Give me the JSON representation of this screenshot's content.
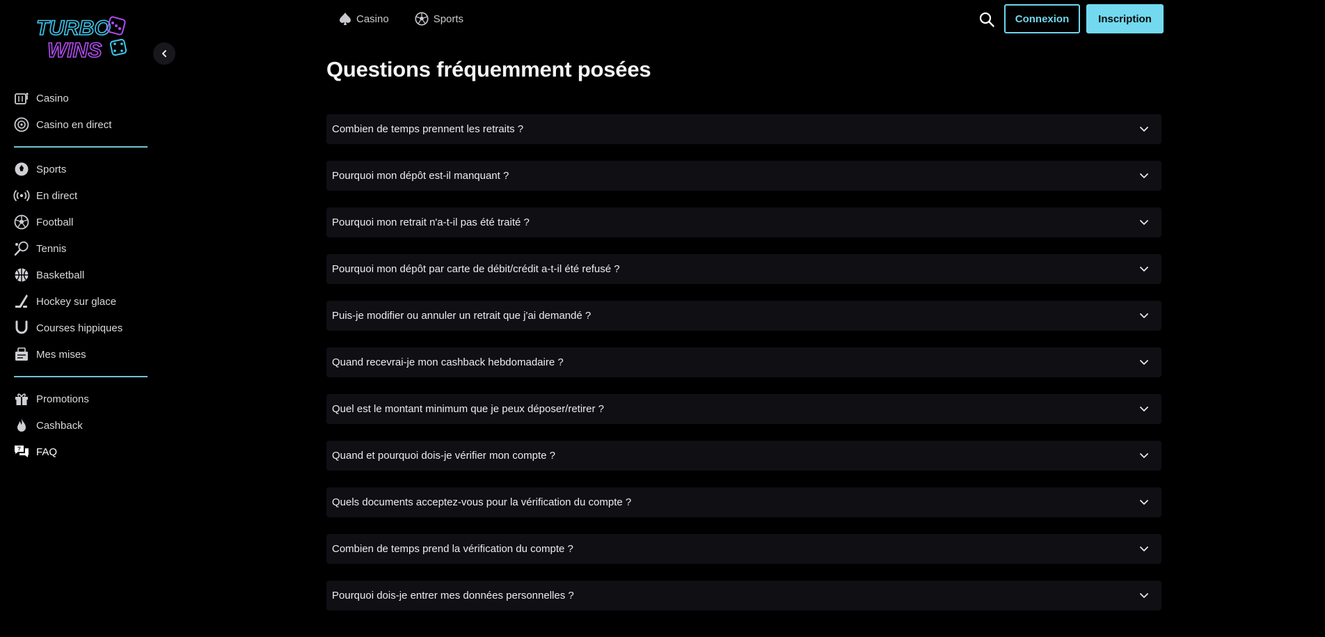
{
  "brand": {
    "logo_line1": "TURBO",
    "logo_line2": "WINS",
    "colors": {
      "logo_cyan": "#3ec9f0",
      "logo_magenta": "#b24cf2",
      "accent": "#72d9ef",
      "divider": "#6fc4d2"
    }
  },
  "sidebar": {
    "collapse_icon": "chevron-left-icon",
    "groups": [
      [
        {
          "label": "Casino",
          "icon": "slot-machine-icon"
        },
        {
          "label": "Casino en direct",
          "icon": "roulette-icon"
        }
      ],
      [
        {
          "label": "Sports",
          "icon": "sports-icon"
        },
        {
          "label": "En direct",
          "icon": "live-broadcast-icon"
        },
        {
          "label": "Football",
          "icon": "soccer-ball-icon"
        },
        {
          "label": "Tennis",
          "icon": "tennis-racket-icon"
        },
        {
          "label": "Basketball",
          "icon": "basketball-icon"
        },
        {
          "label": "Hockey sur glace",
          "icon": "hockey-stick-icon"
        },
        {
          "label": "Courses hippiques",
          "icon": "horseshoe-icon"
        },
        {
          "label": "Mes mises",
          "icon": "bet-slip-icon"
        }
      ],
      [
        {
          "label": "Promotions",
          "icon": "gift-icon"
        },
        {
          "label": "Cashback",
          "icon": "flame-icon"
        },
        {
          "label": "FAQ",
          "icon": "faq-chat-icon",
          "active": true
        }
      ]
    ]
  },
  "topnav": {
    "casino_label": "Casino",
    "sports_label": "Sports",
    "search_icon": "search-icon",
    "login_label": "Connexion",
    "signup_label": "Inscription"
  },
  "main": {
    "title": "Questions fréquemment posées",
    "faqs": [
      "Combien de temps prennent les retraits ?",
      "Pourquoi mon dépôt est-il manquant ?",
      "Pourquoi mon retrait n'a-t-il pas été traité ?",
      "Pourquoi mon dépôt par carte de débit/crédit a-t-il été refusé ?",
      "Puis-je modifier ou annuler un retrait que j'ai demandé ?",
      "Quand recevrai-je mon cashback hebdomadaire ?",
      "Quel est le montant minimum que je peux déposer/retirer ?",
      "Quand et pourquoi dois-je vérifier mon compte ?",
      "Quels documents acceptez-vous pour la vérification du compte ?",
      "Combien de temps prend la vérification du compte ?",
      "Pourquoi dois-je entrer mes données personnelles ?"
    ]
  }
}
